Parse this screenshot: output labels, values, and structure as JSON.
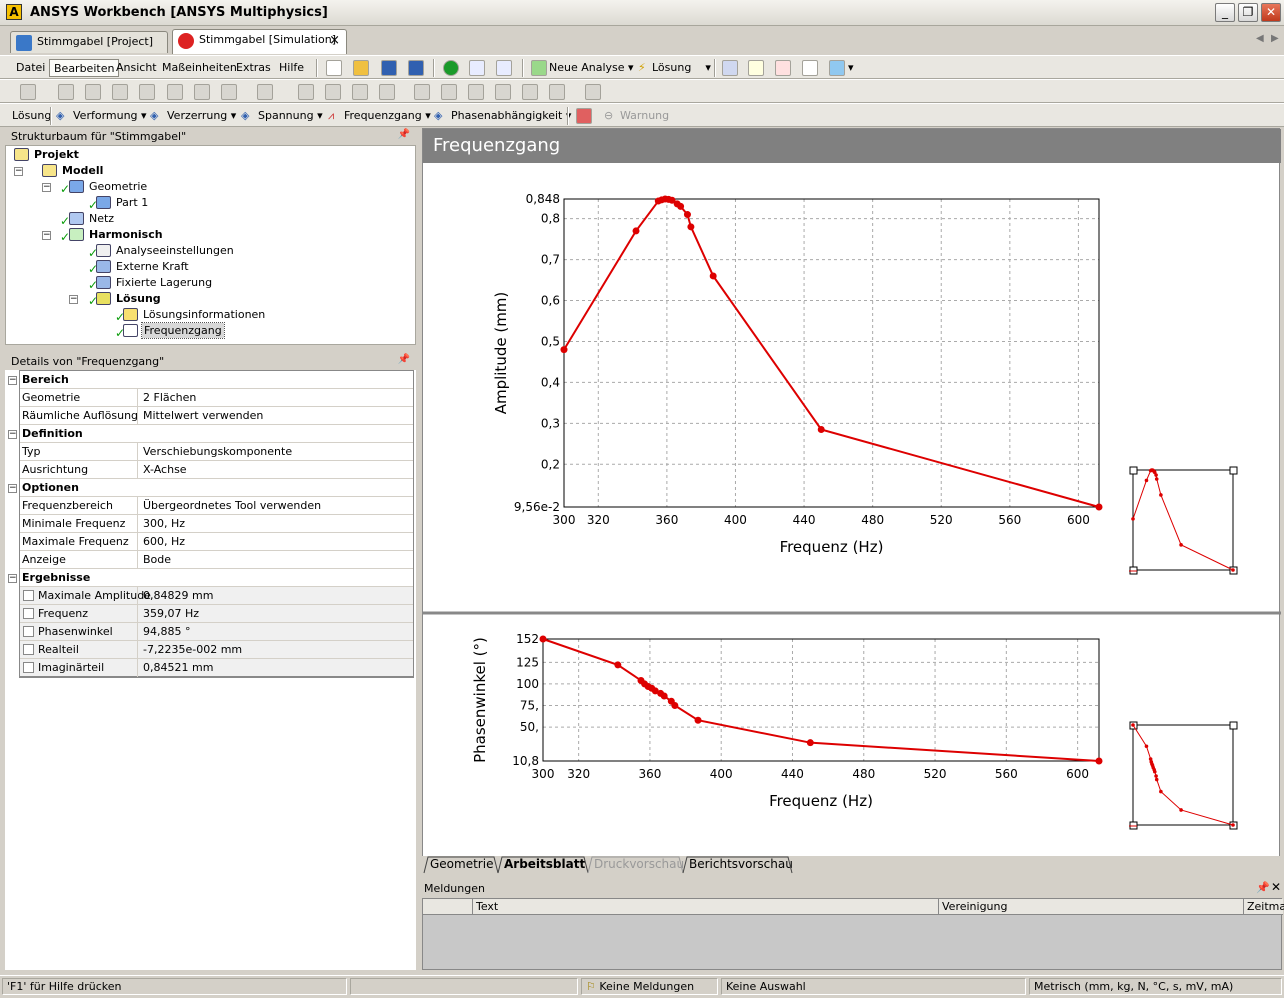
{
  "window": {
    "title": "ANSYS Workbench [ANSYS Multiphysics]",
    "logo_letter": "A"
  },
  "doc_tabs": [
    {
      "label": "Stimmgabel [Project]"
    },
    {
      "label": "Stimmgabel [Simulation]",
      "close": "×"
    }
  ],
  "menu": [
    "Datei",
    "Bearbeiten",
    "Ansicht",
    "Maßeinheiten",
    "Extras",
    "Hilfe"
  ],
  "toolbar1": {
    "neue_analyse": "Neue Analyse",
    "losung": "Lösung"
  },
  "toolbar3": {
    "items": [
      "Lösung",
      "Verformung",
      "Verzerrung",
      "Spannung",
      "Frequenzgang",
      "Phasenabhängigkeit",
      "Warnung"
    ]
  },
  "tree": {
    "header": "Strukturbaum für \"Stimmgabel\"",
    "nodes": [
      "Projekt",
      "Modell",
      "Geometrie",
      "Part 1",
      "Netz",
      "Harmonisch",
      "Analyseeinstellungen",
      "Externe Kraft",
      "Fixierte Lagerung",
      "Lösung",
      "Lösungsinformationen",
      "Frequenzgang"
    ]
  },
  "details": {
    "header": "Details von \"Frequenzgang\"",
    "groups": {
      "bereich": "Bereich",
      "definition": "Definition",
      "optionen": "Optionen",
      "ergebnisse": "Ergebnisse"
    },
    "rows": [
      {
        "key": "Geometrie",
        "val": "2 Flächen"
      },
      {
        "key": "Räumliche Auflösung",
        "val": "Mittelwert verwenden"
      },
      {
        "key": "Typ",
        "val": "Verschiebungskomponente"
      },
      {
        "key": "Ausrichtung",
        "val": "X-Achse"
      },
      {
        "key": "Frequenzbereich",
        "val": "Übergeordnetes Tool verwenden"
      },
      {
        "key": "Minimale Frequenz",
        "val": "300, Hz"
      },
      {
        "key": "Maximale Frequenz",
        "val": "600, Hz"
      },
      {
        "key": "Anzeige",
        "val": "Bode"
      },
      {
        "key": "Maximale Amplitude",
        "val": "0,84829 mm"
      },
      {
        "key": "Frequenz",
        "val": "359,07 Hz"
      },
      {
        "key": "Phasenwinkel",
        "val": "94,885 °"
      },
      {
        "key": "Realteil",
        "val": "-7,2235e-002 mm"
      },
      {
        "key": "Imaginärteil",
        "val": "0,84521 mm"
      }
    ]
  },
  "content": {
    "title": "Frequenzgang"
  },
  "chart_data": [
    {
      "type": "line",
      "xlabel": "Frequenz (Hz)",
      "ylabel": "Amplitude (mm)",
      "xlim": [
        300,
        612
      ],
      "ylim": [
        0.0956,
        0.848
      ],
      "xticks": [
        "300",
        "320",
        "360",
        "400",
        "440",
        "480",
        "520",
        "560",
        "600"
      ],
      "yticks": [
        "9,56e-2",
        "0,2",
        "0,3",
        "0,4",
        "0,5",
        "0,6",
        "0,7",
        "0,8",
        "0,848"
      ],
      "color": "#dd0000",
      "x": [
        300,
        342,
        355,
        357,
        359,
        361,
        363,
        366,
        368,
        372,
        374,
        387,
        450,
        612
      ],
      "y": [
        0.48,
        0.77,
        0.843,
        0.846,
        0.848,
        0.847,
        0.845,
        0.836,
        0.83,
        0.81,
        0.78,
        0.66,
        0.285,
        0.0956
      ]
    },
    {
      "type": "line",
      "xlabel": "Frequenz (Hz)",
      "ylabel": "Phasenwinkel (°)",
      "xlim": [
        300,
        612
      ],
      "ylim": [
        10.8,
        152
      ],
      "xticks": [
        "300",
        "320",
        "360",
        "400",
        "440",
        "480",
        "520",
        "560",
        "600"
      ],
      "yticks": [
        "10,8",
        "50,",
        "75,",
        "100",
        "125",
        "152"
      ],
      "color": "#dd0000",
      "x": [
        300,
        342,
        355,
        357,
        359,
        361,
        363,
        366,
        368,
        372,
        374,
        387,
        450,
        612
      ],
      "y": [
        152,
        122,
        104,
        100,
        97,
        95,
        92,
        89,
        86,
        80,
        75,
        58,
        32,
        10.8
      ]
    }
  ],
  "bottom_tabs": [
    "Geometrie",
    "Arbeitsblatt",
    "Druckvorschau",
    "Berichtsvorschau"
  ],
  "messages": {
    "header": "Meldungen",
    "columns": [
      "Text",
      "Vereinigung",
      "Zeitmar"
    ]
  },
  "status": {
    "help": "'F1' für Hilfe drücken",
    "meldungen": "Keine Meldungen",
    "auswahl": "Keine Auswahl",
    "units": "Metrisch (mm, kg, N, °C, s, mV, mA)"
  }
}
